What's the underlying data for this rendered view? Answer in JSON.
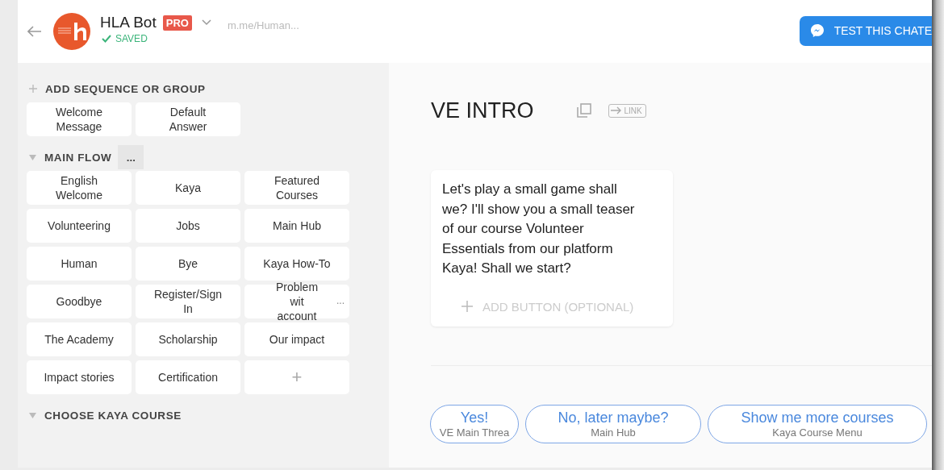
{
  "header": {
    "bot_name": "HLA Bot",
    "plan_badge": "PRO",
    "saved_label": "SAVED",
    "link": "m.me/Human...",
    "test_button": "TEST THIS CHATE"
  },
  "sidebar": {
    "add_label": "ADD SEQUENCE OR GROUP",
    "top_tiles": [
      {
        "label": "Welcome Message"
      },
      {
        "label": "Default Answer"
      }
    ],
    "groups": [
      {
        "title": "MAIN FLOW",
        "expanded": true,
        "menu": "...",
        "tiles": [
          {
            "kind": "block",
            "label": "English Welcome"
          },
          {
            "kind": "block",
            "label": "Kaya"
          },
          {
            "kind": "block",
            "label": "Featured Courses"
          },
          {
            "kind": "block",
            "label": "Volunteering"
          },
          {
            "kind": "block",
            "label": "Jobs"
          },
          {
            "kind": "block",
            "label": "Main Hub"
          },
          {
            "kind": "block",
            "label": "Human"
          },
          {
            "kind": "block",
            "label": "Bye"
          },
          {
            "kind": "block",
            "label": "Kaya How-To"
          },
          {
            "kind": "block",
            "label": "Goodbye"
          },
          {
            "kind": "block",
            "label": "Register/Sign In"
          },
          {
            "kind": "block",
            "label": "Problem wit account",
            "more": "..."
          },
          {
            "kind": "block",
            "label": "The Academy"
          },
          {
            "kind": "block",
            "label": "Scholarship"
          },
          {
            "kind": "block",
            "label": "Our impact"
          },
          {
            "kind": "block",
            "label": "Impact stories"
          },
          {
            "kind": "block",
            "label": "Certification"
          },
          {
            "kind": "add",
            "label": "+"
          }
        ]
      },
      {
        "title": "CHOOSE KAYA COURSE",
        "expanded": true
      }
    ]
  },
  "editor": {
    "title": "VE INTRO",
    "link_label": "LINK",
    "message": "Let's play a small game shall we? I'll show you a small teaser of our course Volunteer Essentials from our platform Kaya! Shall we start?",
    "add_button": "ADD BUTTON (OPTIONAL)",
    "quick_replies": [
      {
        "title": "Yes!",
        "target": "VE Main Threa"
      },
      {
        "title": "No, later maybe?",
        "target": "Main Hub"
      },
      {
        "title": "Show me more courses",
        "target": "Kaya Course Menu"
      }
    ]
  }
}
